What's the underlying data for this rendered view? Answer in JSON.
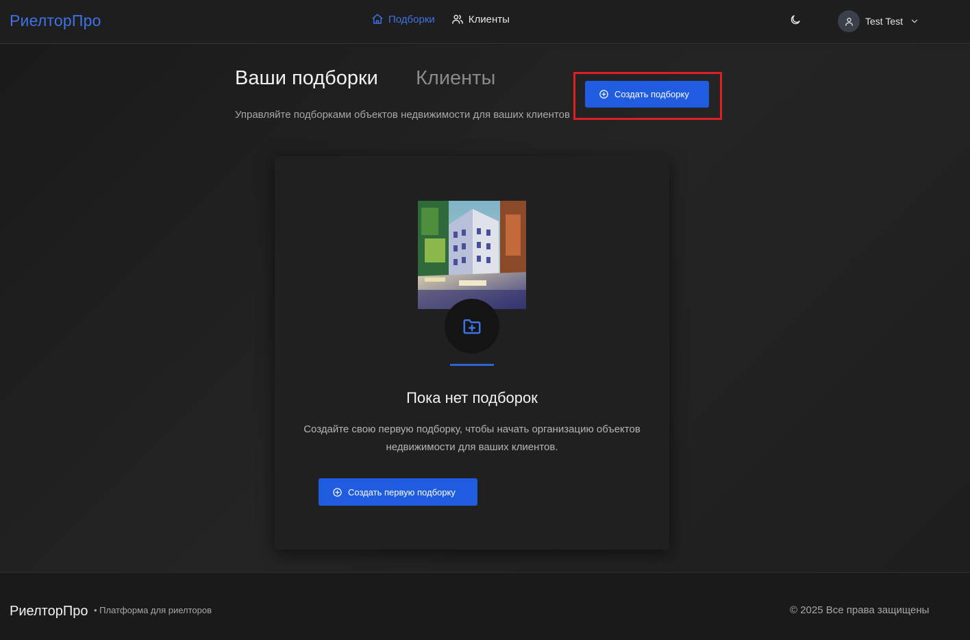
{
  "header": {
    "brand": "РиелторПро",
    "nav": [
      {
        "label": "Подборки",
        "icon": "home-icon",
        "active": true
      },
      {
        "label": "Клиенты",
        "icon": "users-icon",
        "active": false
      }
    ],
    "theme_icon": "moon-icon",
    "user_name": "Test Test"
  },
  "main": {
    "title": "Ваши подборки",
    "tab_clients": "Клиенты",
    "subtitle": "Управляйте подборками объектов недвижимости для ваших клиентов",
    "create_button": "Создать подборку",
    "empty": {
      "icon": "folder-plus-icon",
      "title": "Пока нет подборок",
      "text": "Создайте свою первую подборку, чтобы начать организацию объектов недвижимости для ваших клиентов.",
      "button": "Создать первую подборку"
    }
  },
  "footer": {
    "brand": "РиелторПро",
    "tagline": "• Платформа для риелторов",
    "copyright": "© 2025 Все права защищены"
  },
  "colors": {
    "accent": "#1f5ce0",
    "link": "#3d73e6",
    "highlight": "#e11d26"
  }
}
